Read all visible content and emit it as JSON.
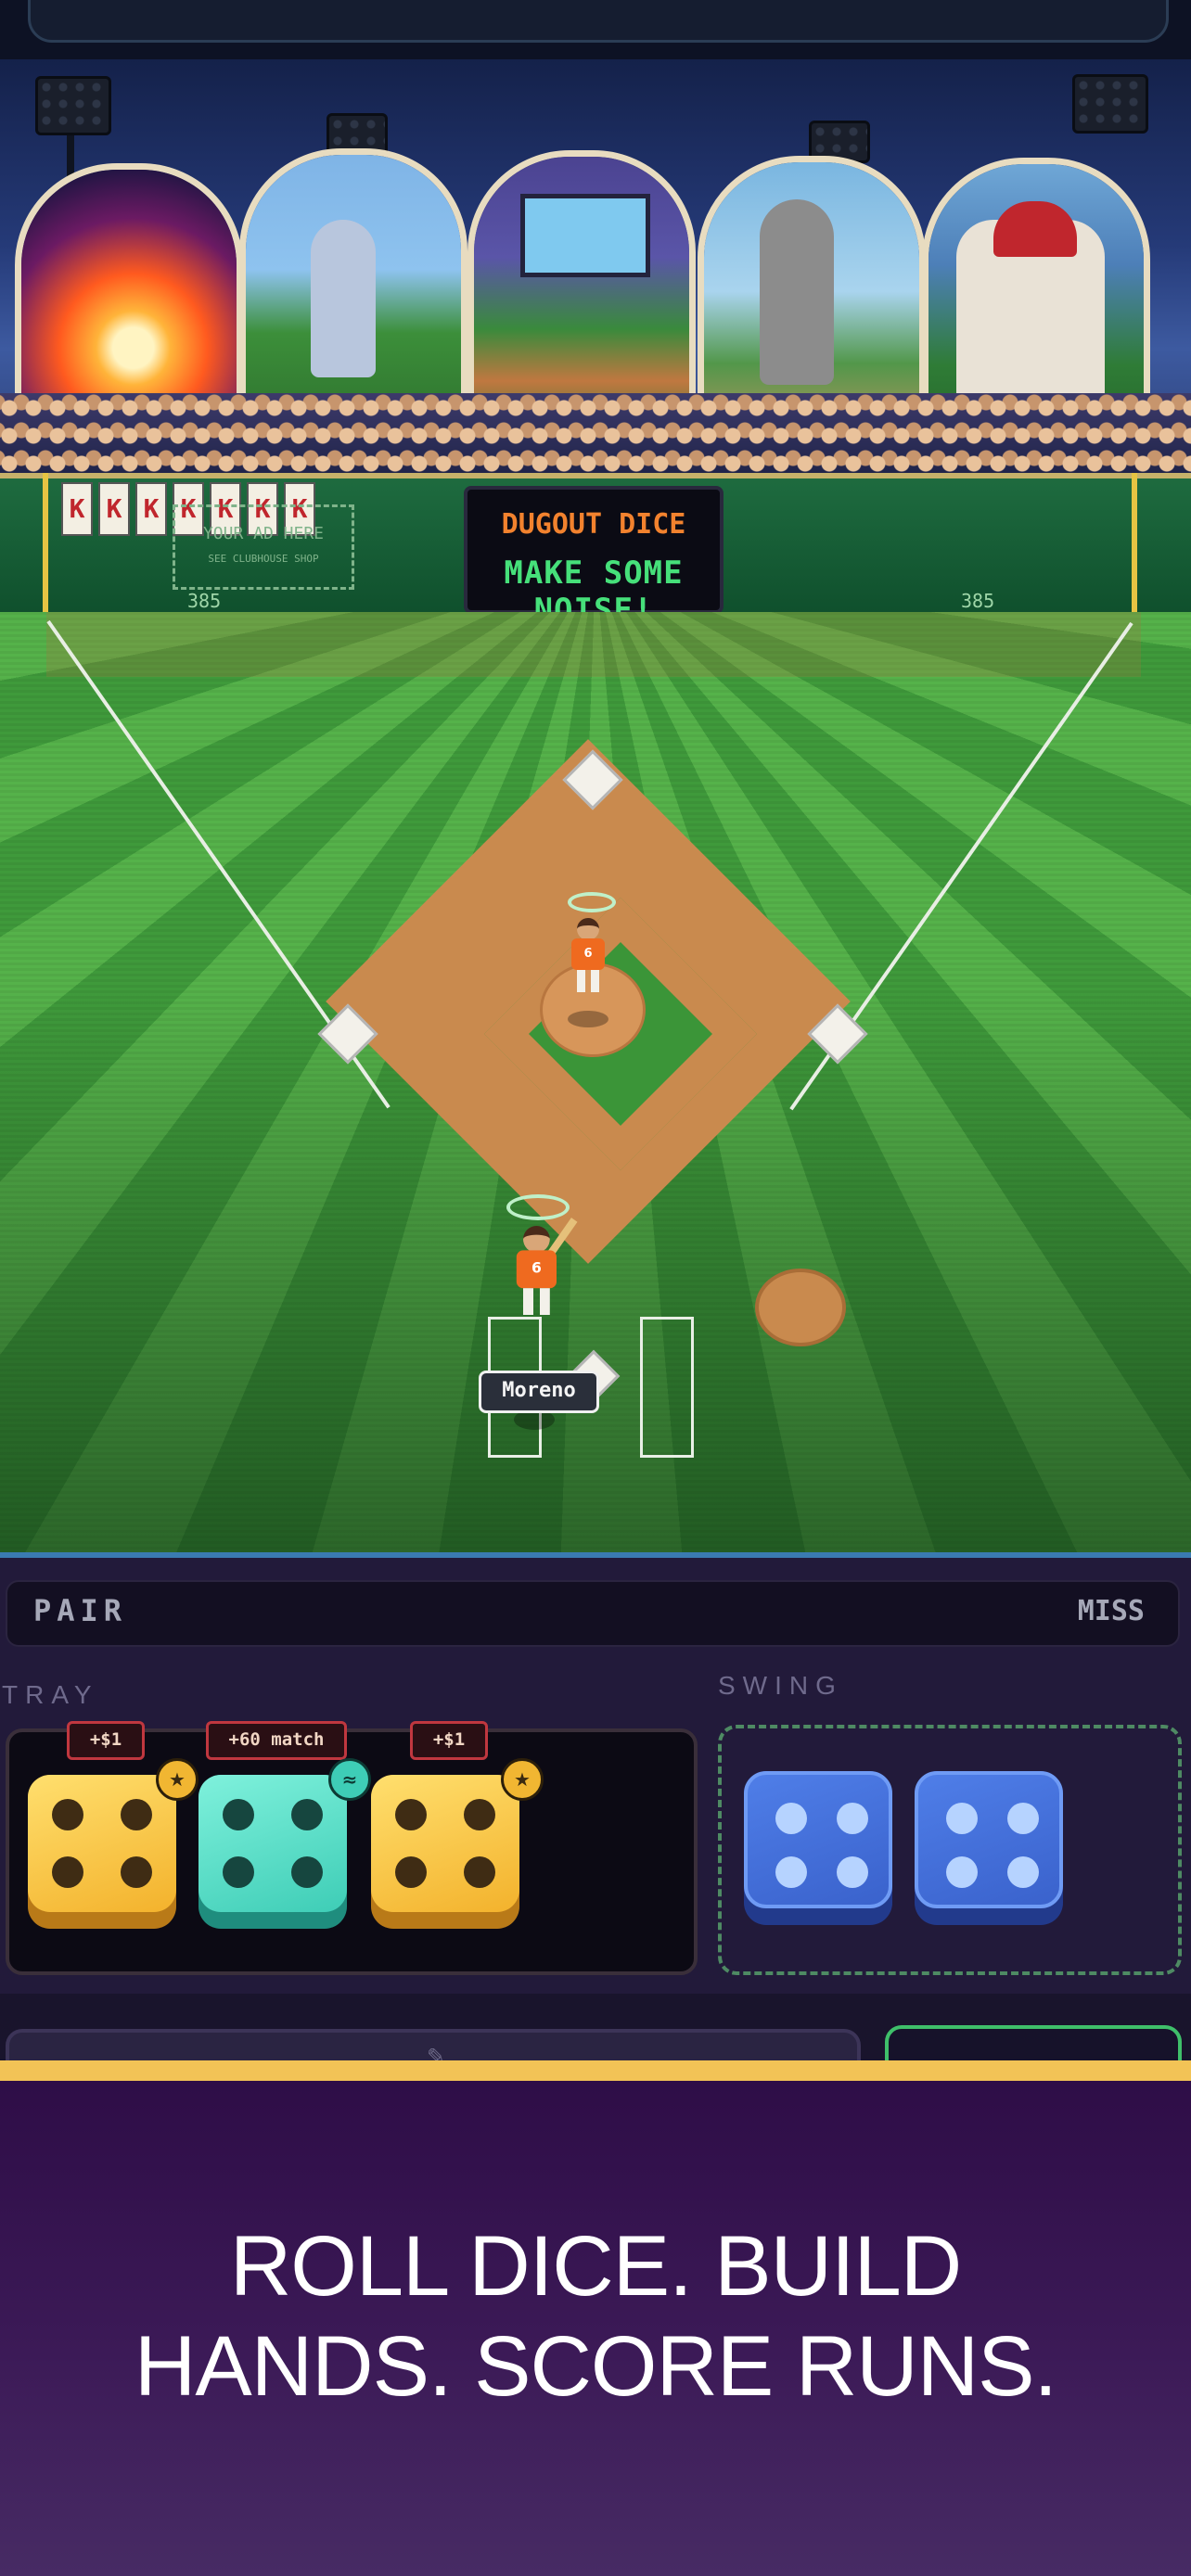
{
  "scoreboard": {
    "title": "DUGOUT DICE",
    "message": "MAKE SOME NOISE!"
  },
  "wall": {
    "strikeout_cards": [
      "K",
      "K",
      "K",
      "K",
      "K",
      "K",
      "K"
    ],
    "ad_line1": "YOUR AD HERE",
    "ad_line2": "SEE CLUBHOUSE SHOP",
    "distance_left": "385",
    "distance_right": "385"
  },
  "field": {
    "pitcher_number": "6",
    "batter_number": "6",
    "batter_name": "Moreno"
  },
  "hand": {
    "name": "PAIR",
    "result": "MISS"
  },
  "tray": {
    "label": "TRAY",
    "dice": [
      {
        "value": 4,
        "color": "gold",
        "tag": "+$1",
        "badge": "★"
      },
      {
        "value": 4,
        "color": "teal",
        "tag": "+60 match",
        "badge": "≈"
      },
      {
        "value": 4,
        "color": "gold",
        "tag": "+$1",
        "badge": "★"
      }
    ]
  },
  "swing": {
    "label": "SWING",
    "dice": [
      {
        "value": 4,
        "color": "blue"
      },
      {
        "value": 4,
        "color": "blue"
      }
    ]
  },
  "promo": {
    "line1": "ROLL DICE. BUILD",
    "line2": "HANDS. SCORE RUNS."
  },
  "colors": {
    "accent_stripe": "#f2c356",
    "promo_bg": "#3c1a57",
    "scoreboard_title": "#f2822e",
    "scoreboard_message": "#46e07a"
  }
}
